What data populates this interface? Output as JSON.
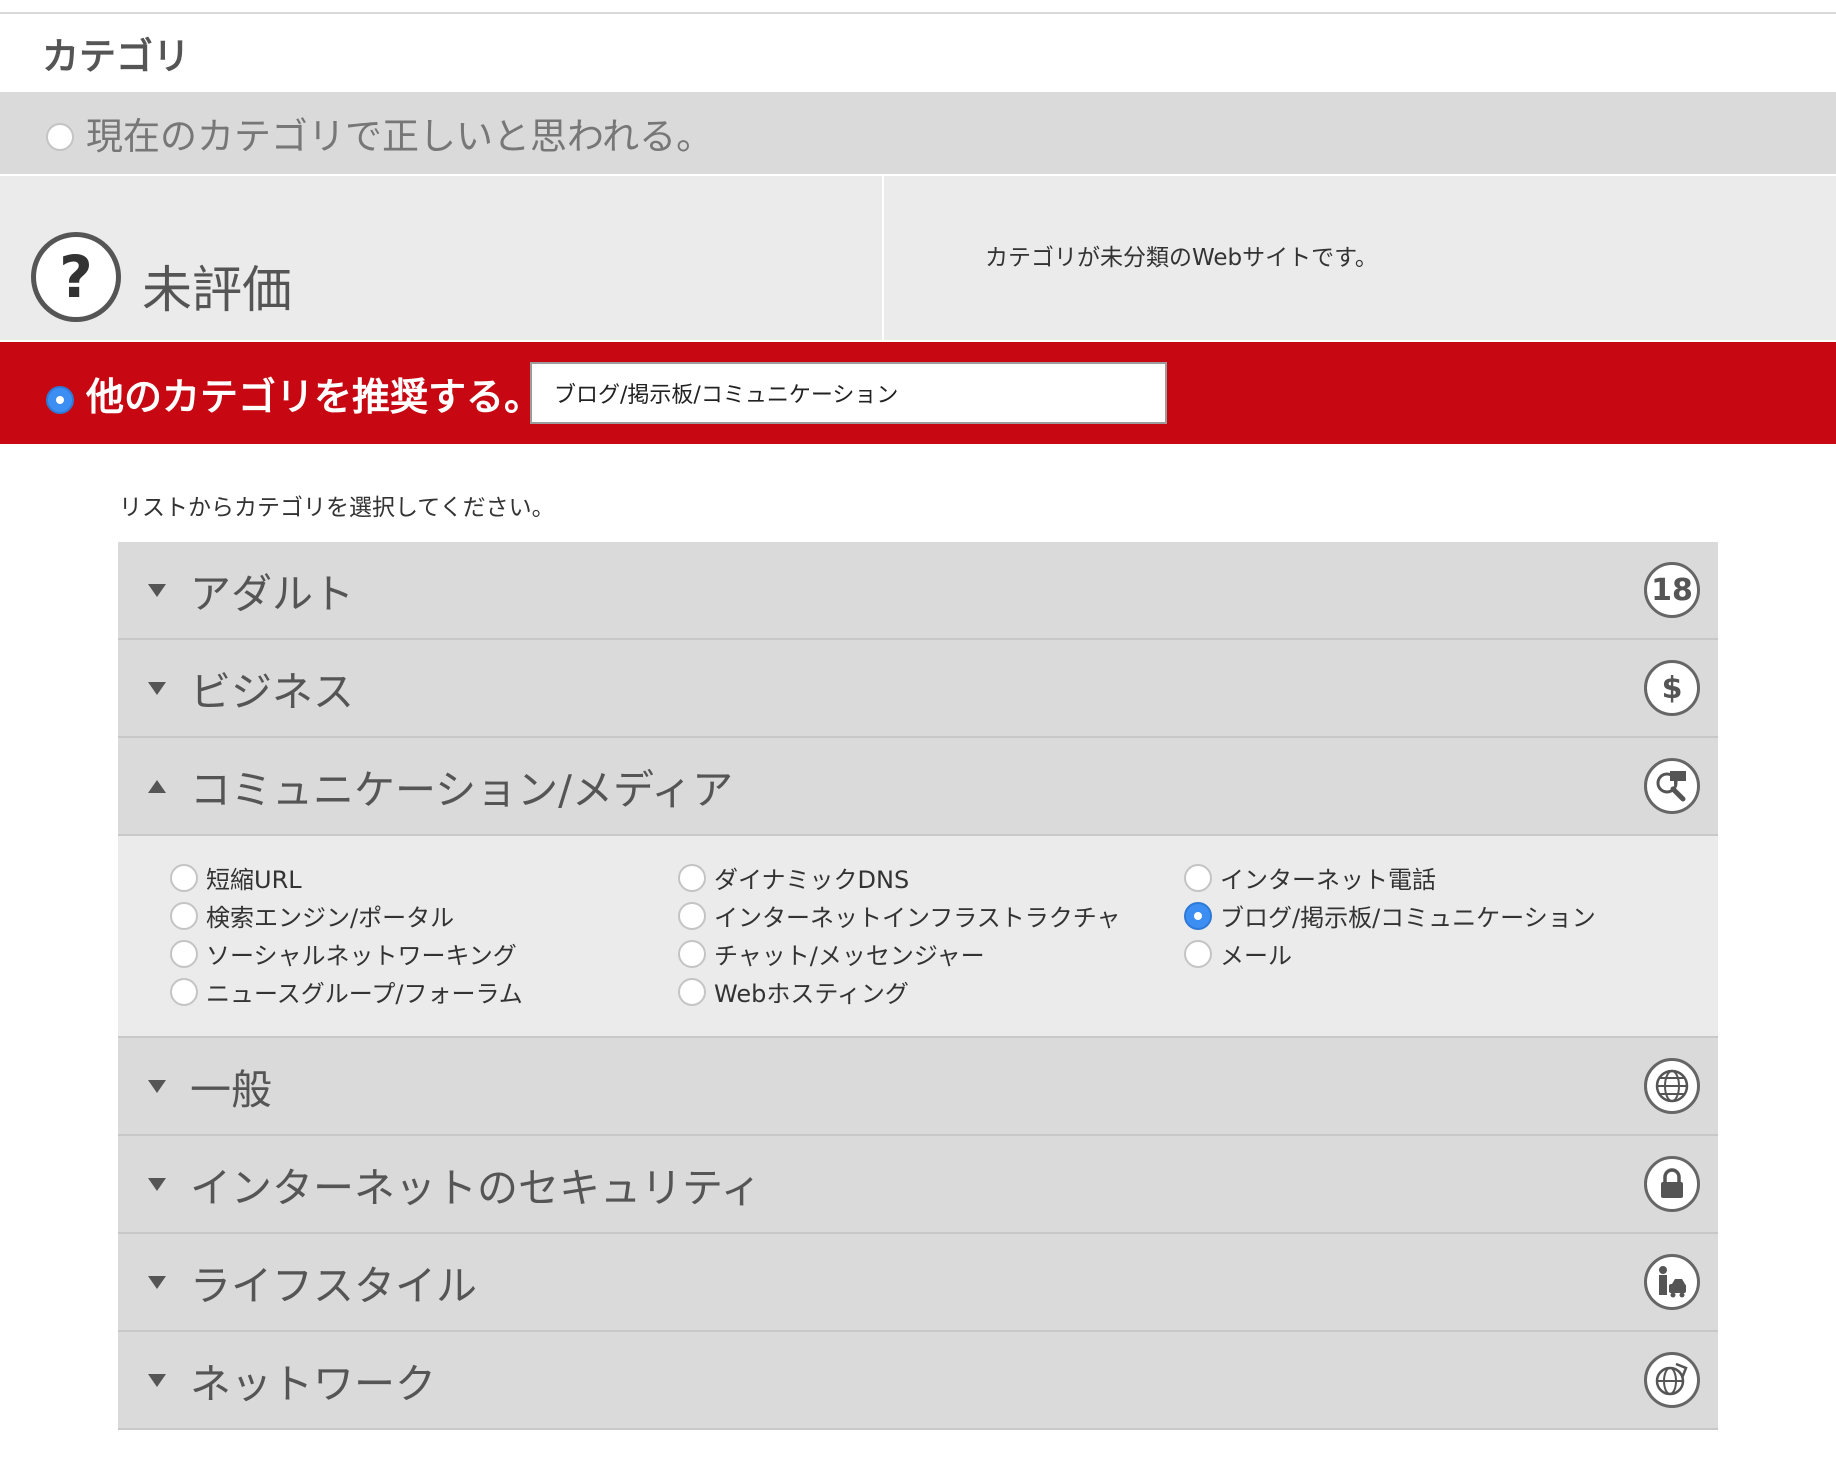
{
  "page": {
    "section_title": "カテゴリ",
    "current": {
      "option_label": "現在のカテゴリで正しいと思われる。",
      "category_name": "未評価",
      "category_icon": "question-mark-icon",
      "description": "カテゴリが未分類のWebサイトです。"
    },
    "recommend": {
      "option_label": "他のカテゴリを推奨する。",
      "selected_value": "ブログ/掲示板/コミュニケーション"
    },
    "hint": "リストからカテゴリを選択してください。"
  },
  "colors": {
    "accent_red": "#c70712",
    "radio_selected": "#3d8ef3",
    "panel_gray": "#dbdadb",
    "panel_light": "#ebebeb"
  },
  "categories": [
    {
      "label": "アダルト",
      "icon": "age-18-icon",
      "icon_text": "18",
      "expanded": false
    },
    {
      "label": "ビジネス",
      "icon": "dollar-icon",
      "icon_text": "$",
      "expanded": false
    },
    {
      "label": "コミュニケーション/メディア",
      "icon": "search-chat-icon",
      "expanded": true,
      "subcategories": [
        [
          "短縮URL",
          "検索エンジン/ポータル",
          "ソーシャルネットワーキング",
          "ニュースグループ/フォーラム"
        ],
        [
          "ダイナミックDNS",
          "インターネットインフラストラクチャ",
          "チャット/メッセンジャー",
          "Webホスティング"
        ],
        [
          "インターネット電話",
          "ブログ/掲示板/コミュニケーション",
          "メール"
        ]
      ],
      "selected": "ブログ/掲示板/コミュニケーション"
    },
    {
      "label": "一般",
      "icon": "globe-icon",
      "expanded": false
    },
    {
      "label": "インターネットのセキュリティ",
      "icon": "lock-icon",
      "expanded": false
    },
    {
      "label": "ライフスタイル",
      "icon": "person-car-icon",
      "expanded": false
    },
    {
      "label": "ネットワーク",
      "icon": "network-globe-icon",
      "expanded": false
    }
  ]
}
